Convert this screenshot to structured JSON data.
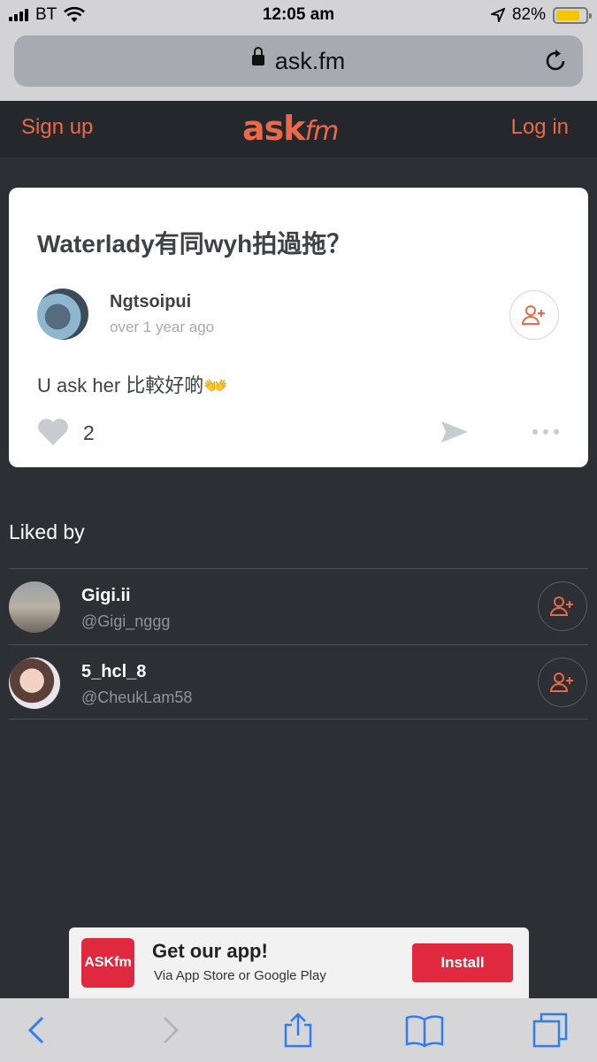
{
  "status_bar": {
    "carrier": "BT",
    "time": "12:05 am",
    "battery": "82%",
    "battery_level": 0.82
  },
  "browser": {
    "url": "ask.fm"
  },
  "header": {
    "signup_label": "Sign up",
    "login_label": "Log in",
    "logo_main": "ASK",
    "logo_suffix": "fm",
    "brand_color": "#ec6848"
  },
  "card": {
    "question": "Waterlady有同wyh拍過拖？",
    "author_name": "Ngtsoipui",
    "author_time": "over 1 year ago",
    "answer": "U ask her 比較好啲👐",
    "like_count": "2"
  },
  "liked_by": {
    "title": "Liked by",
    "users": [
      {
        "name": "Gigi.ii",
        "handle": "@Gigi_nggg"
      },
      {
        "name": "5_hcl_8",
        "handle": "@CheukLam58"
      }
    ]
  },
  "app_banner": {
    "logo_text": "ASKfm",
    "title": "Get our app!",
    "subtitle": "Via App Store or Google Play",
    "install_label": "Install"
  },
  "icons": {
    "back": "chevron-left-icon",
    "forward": "chevron-right-icon",
    "share": "share-icon",
    "bookmarks": "book-icon",
    "tabs": "tabs-icon"
  }
}
